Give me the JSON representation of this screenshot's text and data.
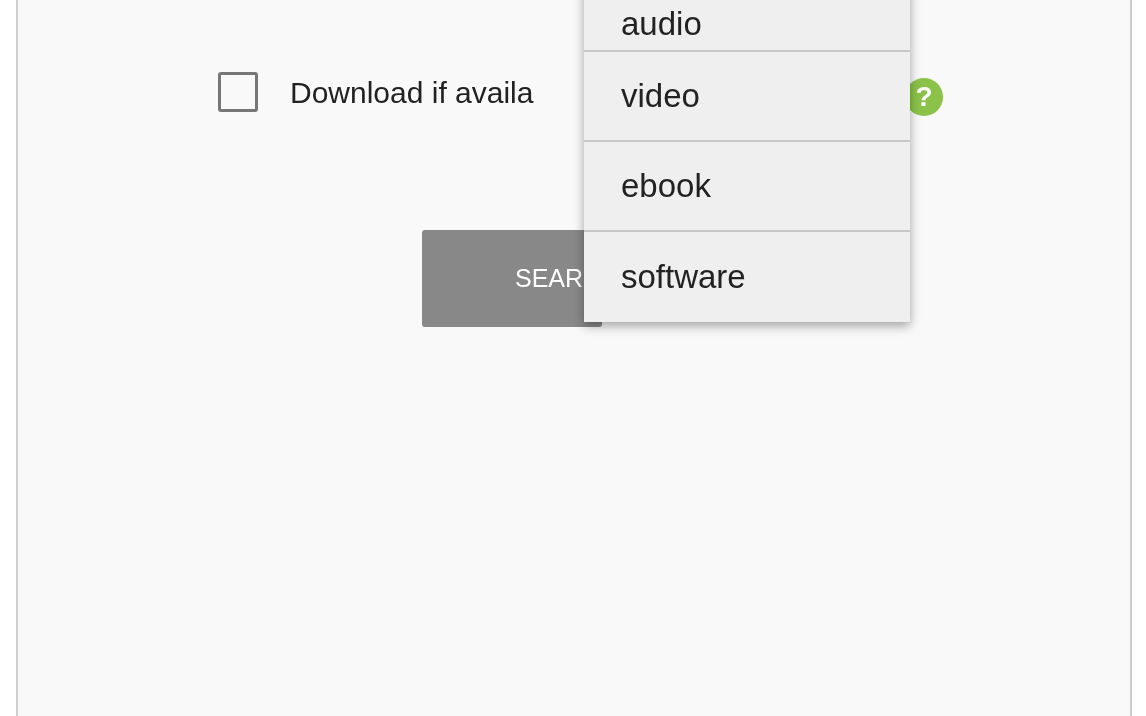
{
  "download_option": {
    "label": "Download if availa",
    "checked": false,
    "help_icon": "?"
  },
  "search_button": {
    "label": "SEAR"
  },
  "menu": {
    "items": [
      {
        "label": "audio",
        "selected": false
      },
      {
        "label": "video",
        "selected": false
      },
      {
        "label": "ebook",
        "selected": false
      },
      {
        "label": "software",
        "selected": false
      }
    ]
  }
}
